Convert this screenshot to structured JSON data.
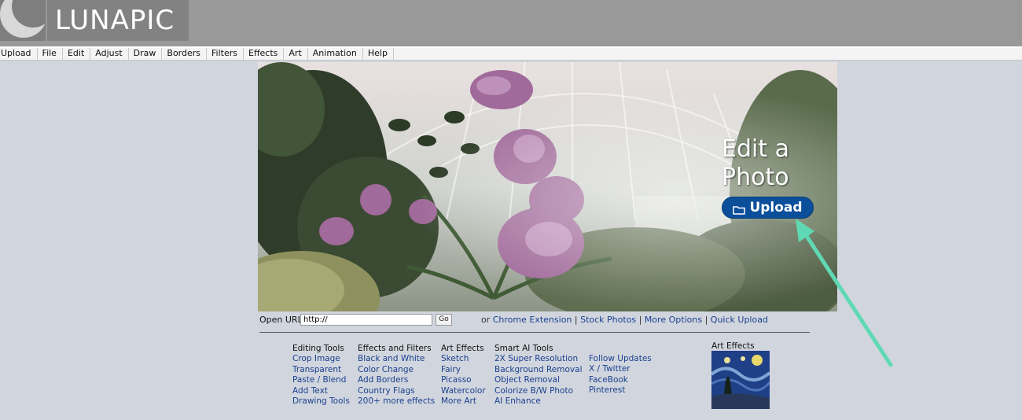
{
  "brand": {
    "logo_text": "LUNAPIC"
  },
  "menu": [
    "Upload",
    "File",
    "Edit",
    "Adjust",
    "Draw",
    "Borders",
    "Filters",
    "Effects",
    "Art",
    "Animation",
    "Help"
  ],
  "hero": {
    "title_line1": "Edit a",
    "title_line2": "Photo",
    "upload_label": "Upload"
  },
  "url_bar": {
    "label": "Open URL:",
    "input_value": "http://",
    "go_label": "Go",
    "prefix": "or",
    "links": [
      "Chrome Extension",
      "Stock Photos",
      "More Options",
      "Quick Upload"
    ],
    "separator": " | "
  },
  "columns": [
    {
      "heading": "Editing Tools",
      "items": [
        "Crop Image",
        "Transparent",
        "Paste / Blend",
        "Add Text",
        "Drawing Tools"
      ]
    },
    {
      "heading": "Effects and Filters",
      "items": [
        "Black and White",
        "Color Change",
        "Add Borders",
        "Country Flags",
        "200+ more effects"
      ]
    },
    {
      "heading": "Art Effects",
      "items": [
        "Sketch",
        "Fairy",
        "Picasso",
        "Watercolor",
        "More Art"
      ]
    },
    {
      "heading": "Smart AI Tools",
      "items": [
        "2X Super Resolution",
        "Background Removal",
        "Object Removal",
        "Colorize B/W Photo",
        "AI Enhance"
      ]
    },
    {
      "heading": "",
      "items": [
        "Follow Updates",
        "X / Twitter",
        "FaceBook",
        "Pinterest"
      ]
    }
  ],
  "art_thumb_label": "Art Effects",
  "colors": {
    "link": "#1a3f8f",
    "upload_button": "#0b4f9b",
    "arrow": "#5fd9b4",
    "background": "#d1d6de"
  }
}
